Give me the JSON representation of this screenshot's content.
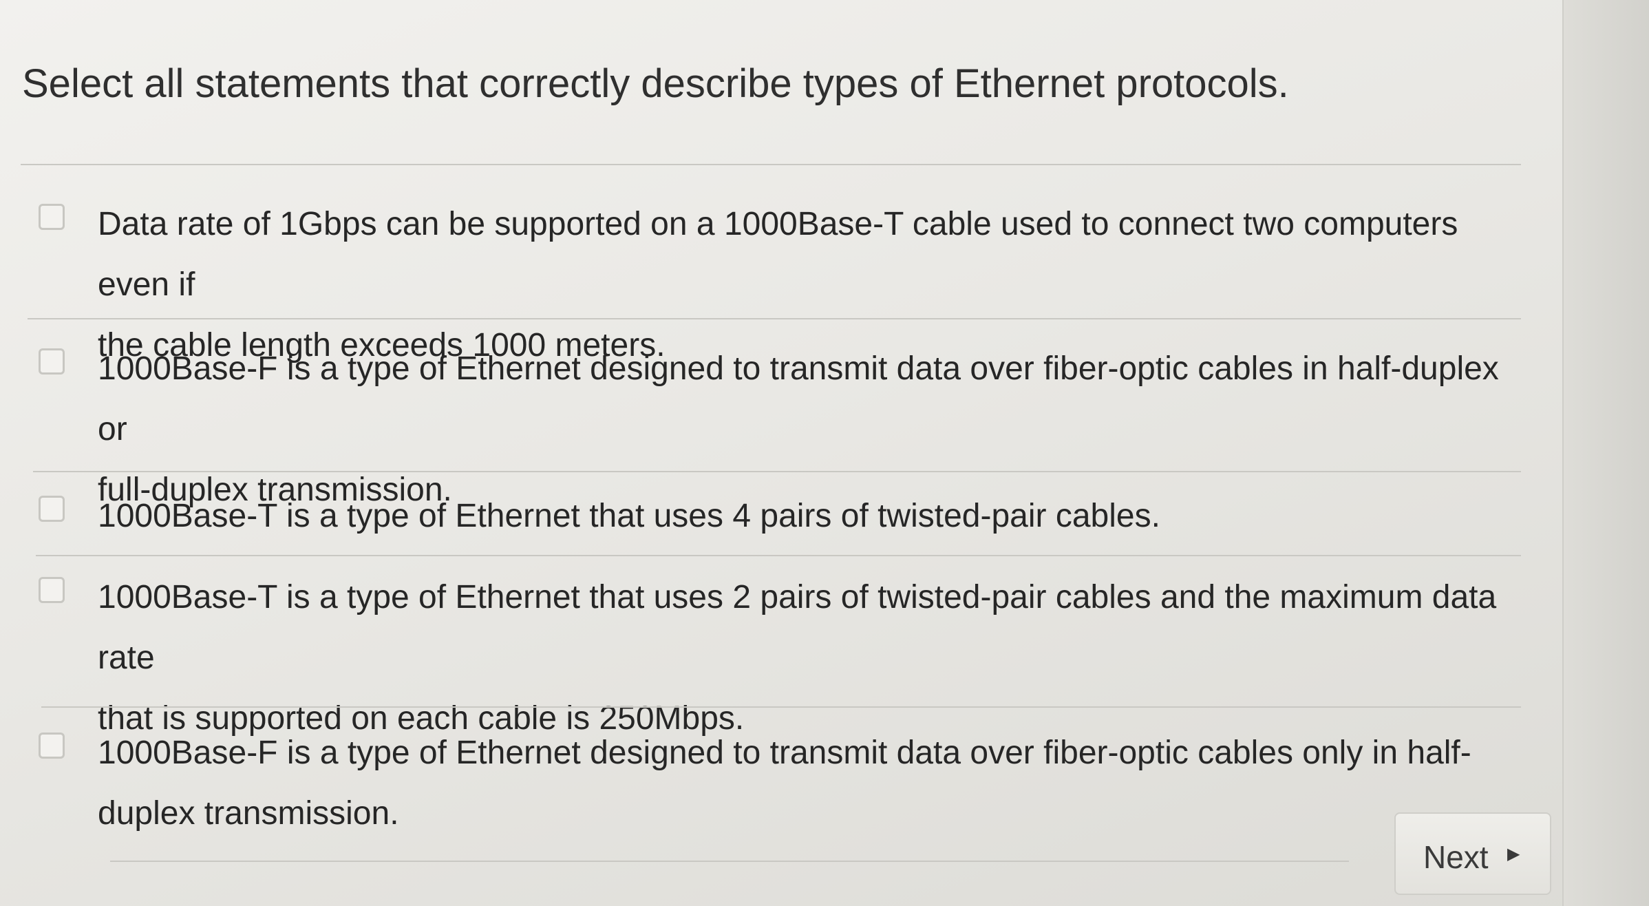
{
  "question": {
    "title": "Select all statements that correctly describe types of Ethernet protocols."
  },
  "options": [
    {
      "line1": "Data rate of 1Gbps can be supported on a 1000Base-T cable used to connect two computers even if",
      "line2": "the cable length exceeds 1000 meters.",
      "checked": false
    },
    {
      "line1": "1000Base-F is a type of Ethernet designed to transmit data over fiber-optic cables in half-duplex or",
      "line2": "full-duplex transmission.",
      "checked": false
    },
    {
      "line1": "1000Base-T is a type of Ethernet that uses 4 pairs of twisted-pair cables.",
      "line2": "",
      "checked": false
    },
    {
      "line1": "1000Base-T is a type of Ethernet that uses 2 pairs of twisted-pair cables and the maximum data rate",
      "line2": "that is supported on each cable is 250Mbps.",
      "checked": false
    },
    {
      "line1": "1000Base-F is a type of Ethernet designed to transmit data over fiber-optic cables only in half-",
      "line2": "duplex transmission.",
      "checked": false
    }
  ],
  "footer": {
    "next_label": "Next",
    "next_icon": "triangle-right-icon"
  }
}
